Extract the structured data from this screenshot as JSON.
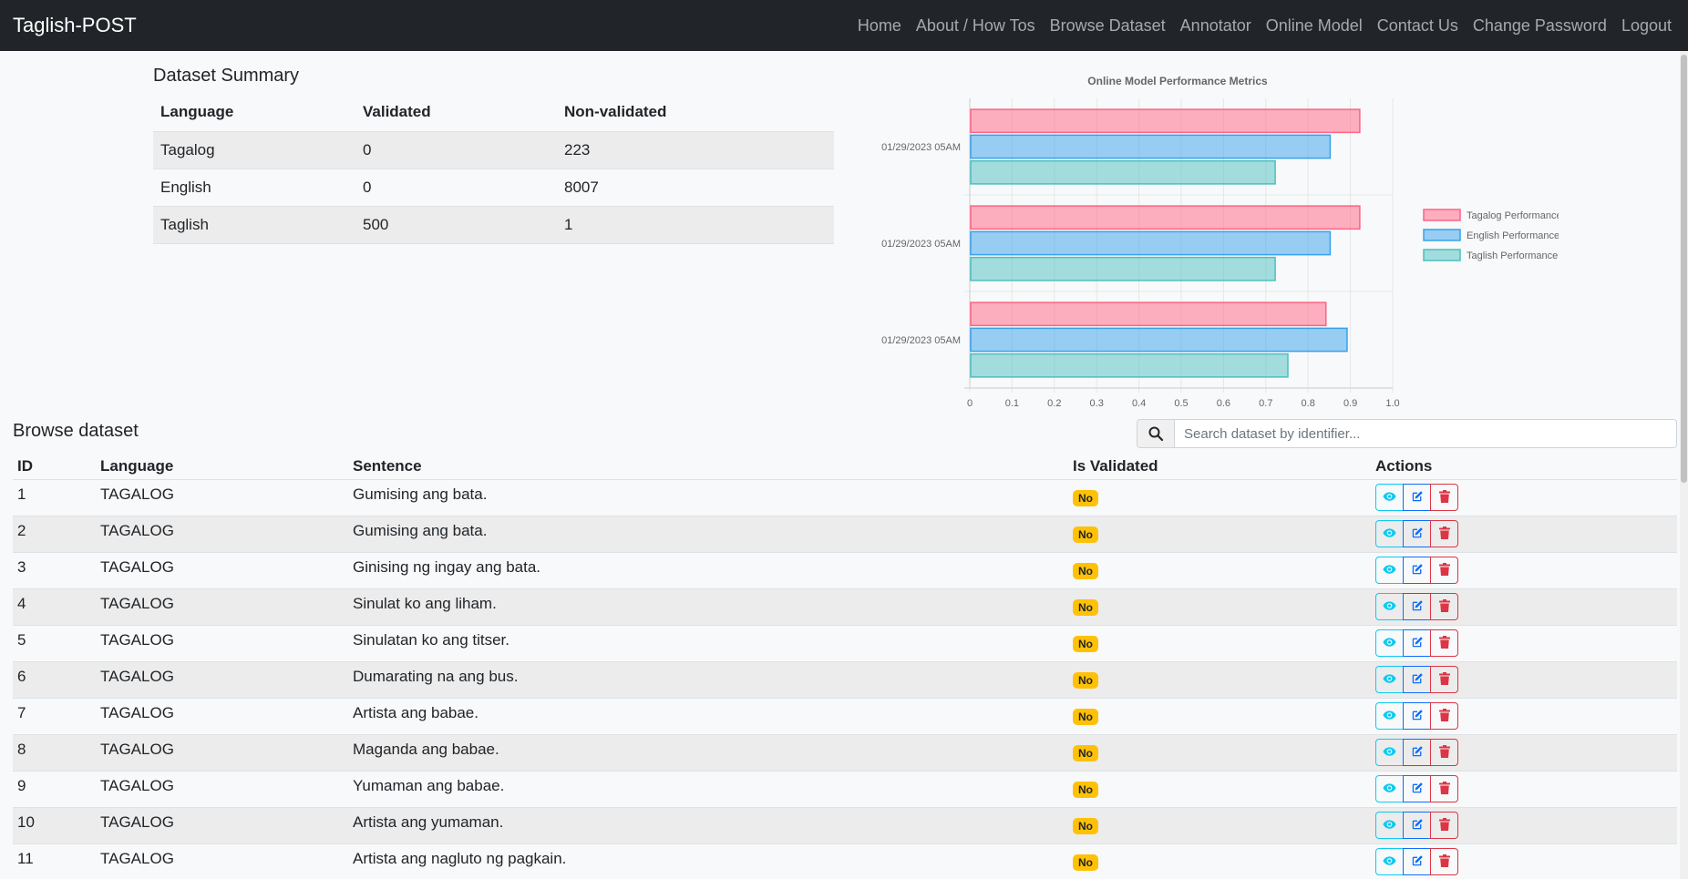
{
  "navbar": {
    "brand": "Taglish-POST",
    "links": [
      "Home",
      "About / How Tos",
      "Browse Dataset",
      "Annotator",
      "Online Model",
      "Contact Us",
      "Change Password",
      "Logout"
    ]
  },
  "summary": {
    "title": "Dataset Summary",
    "headers": [
      "Language",
      "Validated",
      "Non-validated"
    ],
    "rows": [
      [
        "Tagalog",
        "0",
        "223"
      ],
      [
        "English",
        "0",
        "8007"
      ],
      [
        "Taglish",
        "500",
        "1"
      ]
    ]
  },
  "chart_data": {
    "type": "bar",
    "orientation": "horizontal",
    "title": "Online Model Performance Metrics",
    "categories": [
      "01/29/2023 05AM",
      "01/29/2023 05AM",
      "01/29/2023 05AM"
    ],
    "series": [
      {
        "name": "Tagalog Performance",
        "values": [
          0.92,
          0.92,
          0.84
        ],
        "color": "#ff6384"
      },
      {
        "name": "English Performance",
        "values": [
          0.85,
          0.85,
          0.89
        ],
        "color": "#36a2eb"
      },
      {
        "name": "Taglish Performance",
        "values": [
          0.72,
          0.72,
          0.75
        ],
        "color": "#4bc0c0"
      }
    ],
    "xlim": [
      0,
      1.0
    ],
    "xticks": [
      "0",
      "0.1",
      "0.2",
      "0.3",
      "0.4",
      "0.5",
      "0.6",
      "0.7",
      "0.8",
      "0.9",
      "1.0"
    ],
    "legend": "right",
    "grid": true
  },
  "browse": {
    "title": "Browse dataset",
    "search_placeholder": "Search dataset by identifier...",
    "headers": [
      "ID",
      "Language",
      "Sentence",
      "Is Validated",
      "Actions"
    ],
    "rows": [
      {
        "id": "1",
        "language": "TAGALOG",
        "sentence": "Gumising ang bata.",
        "validated": "No"
      },
      {
        "id": "2",
        "language": "TAGALOG",
        "sentence": "Gumising ang bata.",
        "validated": "No"
      },
      {
        "id": "3",
        "language": "TAGALOG",
        "sentence": "Ginising ng ingay ang bata.",
        "validated": "No"
      },
      {
        "id": "4",
        "language": "TAGALOG",
        "sentence": "Sinulat ko ang liham.",
        "validated": "No"
      },
      {
        "id": "5",
        "language": "TAGALOG",
        "sentence": "Sinulatan ko ang titser.",
        "validated": "No"
      },
      {
        "id": "6",
        "language": "TAGALOG",
        "sentence": "Dumarating na ang bus.",
        "validated": "No"
      },
      {
        "id": "7",
        "language": "TAGALOG",
        "sentence": "Artista ang babae.",
        "validated": "No"
      },
      {
        "id": "8",
        "language": "TAGALOG",
        "sentence": "Maganda ang babae.",
        "validated": "No"
      },
      {
        "id": "9",
        "language": "TAGALOG",
        "sentence": "Yumaman ang babae.",
        "validated": "No"
      },
      {
        "id": "10",
        "language": "TAGALOG",
        "sentence": "Artista ang yumaman.",
        "validated": "No"
      },
      {
        "id": "11",
        "language": "TAGALOG",
        "sentence": "Artista ang nagluto ng pagkain.",
        "validated": "No"
      }
    ]
  }
}
